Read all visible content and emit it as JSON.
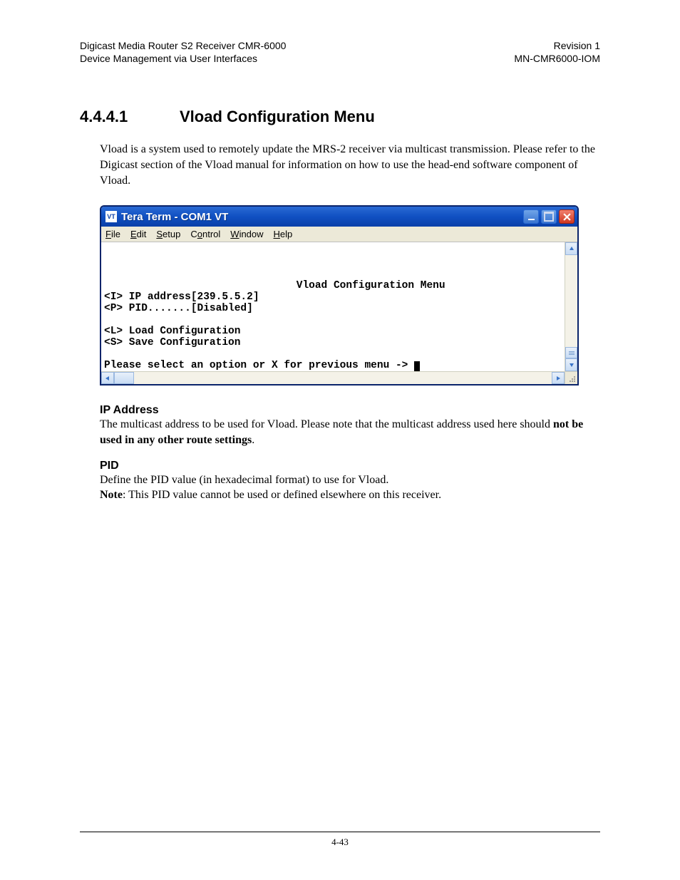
{
  "header": {
    "left_line1": "Digicast Media Router S2 Receiver CMR-6000",
    "left_line2": "Device Management via User Interfaces",
    "right_line1": "Revision 1",
    "right_line2": "MN-CMR6000-IOM"
  },
  "section": {
    "number": "4.4.4.1",
    "title": "Vload Configuration Menu"
  },
  "intro_para": "Vload is a system used to remotely update the MRS-2 receiver via multicast transmission. Please refer to the Digicast section of the Vload manual for information on how to use the head-end software component of Vload.",
  "terminal": {
    "window_title": "Tera Term - COM1 VT",
    "menubar": {
      "file": "File",
      "edit": "Edit",
      "setup": "Setup",
      "control": "Control",
      "window": "Window",
      "help": "Help"
    },
    "content": {
      "heading": "Vload Configuration Menu",
      "line_ip": "<I> IP address[239.5.5.2]",
      "line_pid": "<P> PID.......[Disabled]",
      "line_load": "<L> Load Configuration",
      "line_save": "<S> Save Configuration",
      "line_prompt": "Please select an option or X for previous menu -> "
    }
  },
  "ip_address": {
    "heading": "IP Address",
    "text_pre": "The multicast address to be used for Vload. Please note that the multicast address used here should ",
    "text_bold": "not be used in any other route settings",
    "text_post": "."
  },
  "pid": {
    "heading": "PID",
    "line1": "Define the PID value (in hexadecimal format) to use for Vload.",
    "note_label": "Note",
    "note_text": ": This PID value cannot be used or defined elsewhere on this receiver."
  },
  "footer": {
    "page": "4-43"
  }
}
